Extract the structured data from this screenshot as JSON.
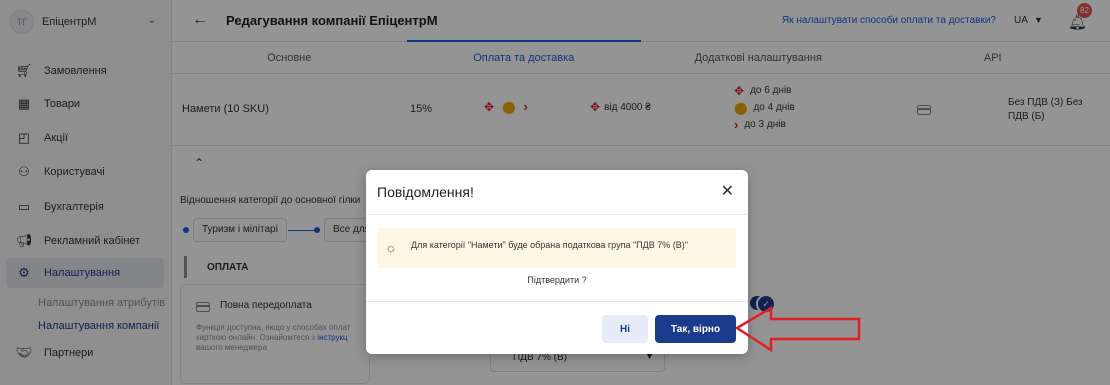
{
  "sidebar": {
    "company_avatar": "ТГ",
    "company_name": "ЕпіцентрМ",
    "items": [
      {
        "label": "Замовлення",
        "icon": "cart-icon"
      },
      {
        "label": "Товари",
        "icon": "grid-icon"
      },
      {
        "label": "Акції",
        "icon": "promo-icon"
      },
      {
        "label": "Користувачі",
        "icon": "users-icon"
      },
      {
        "label": "Бухгалтерія",
        "icon": "folder-icon"
      },
      {
        "label": "Рекламний кабінет",
        "icon": "megaphone-icon"
      },
      {
        "label": "Налаштування",
        "icon": "gear-icon"
      },
      {
        "label": "Партнери",
        "icon": "handshake-icon"
      }
    ],
    "subitems": [
      "Налаштування атрибутів",
      "Налаштування компанії"
    ]
  },
  "header": {
    "title": "Редагування компанії ЕпіцентрМ",
    "help_link": "Як налаштувати способи оплати та доставки?",
    "lang": "UA",
    "notifications": "82"
  },
  "tabs": [
    "Основне",
    "Оплата та доставка",
    "Додаткові налаштування",
    "API"
  ],
  "row": {
    "category": "Намети (10 SKU)",
    "commission": "15%",
    "free_from": "від 4000 ₴",
    "delivery": [
      "до 6 днів",
      "до 4 днів",
      "до 3 днів"
    ],
    "vat": "Без ПДВ (З) Без ПДВ (Б)"
  },
  "content": {
    "relation_label": "Відношення категорії до основної гілки",
    "chip1": "Туризм і мілітарі",
    "chip2": "Все для",
    "payment_section": "ОПЛАТА",
    "prepay_title": "Повна передоплата",
    "prepay_text_1": "Функція доступна, якщо у способах оплат",
    "prepay_text_2": "карткою онлайн. Ознайомтеся з ",
    "prepay_link": "інструкц",
    "prepay_text_3": "вашого менеджера",
    "vat_select": "ПДВ 7% (В)"
  },
  "modal": {
    "title": "Повідомлення!",
    "notice": "Для категорії \"Намети\" буде обрана податкова група \"ПДВ 7% (В)\"",
    "question": "Підтвердити ?",
    "no_label": "Ні",
    "yes_label": "Так, вірно"
  },
  "colors": {
    "accent": "#1b3b8c",
    "link": "#1b5bd6",
    "annotation_arrow": "#e02020",
    "notice_bg": "#fdf7e3"
  }
}
